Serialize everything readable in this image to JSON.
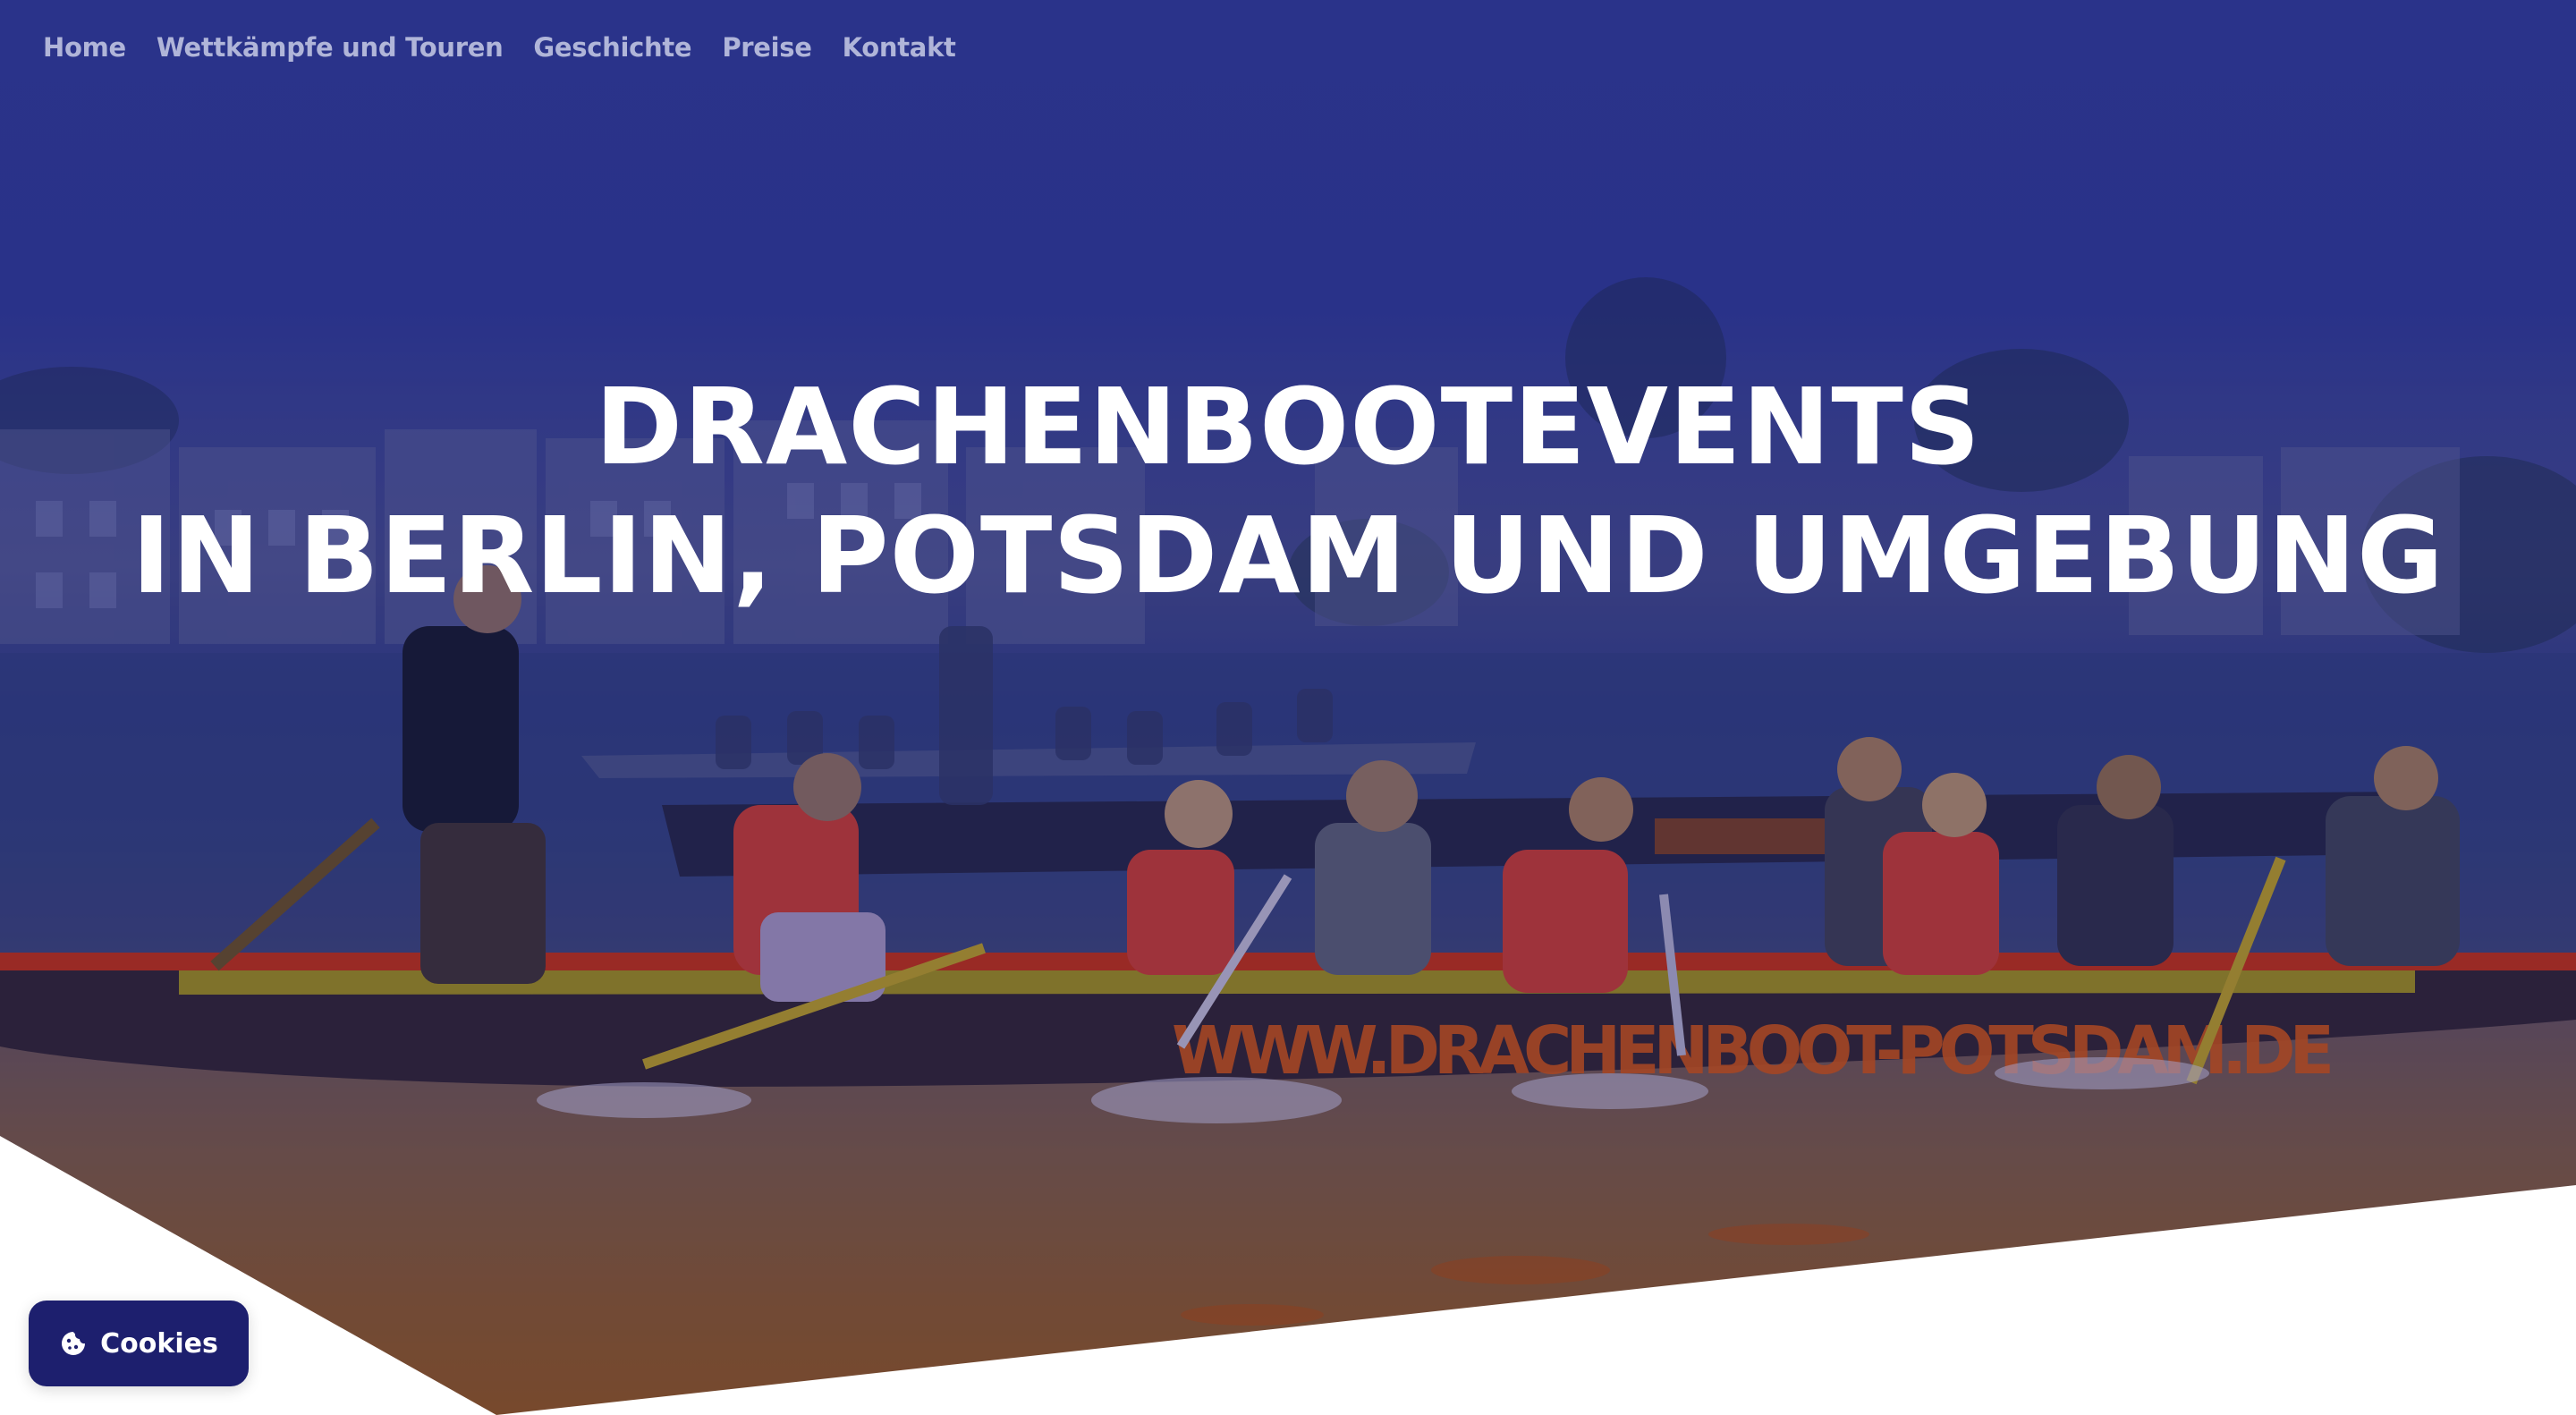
{
  "nav": {
    "items": [
      {
        "label": "Home"
      },
      {
        "label": "Wettkämpfe und Touren"
      },
      {
        "label": "Geschichte"
      },
      {
        "label": "Preise"
      },
      {
        "label": "Kontakt"
      }
    ]
  },
  "hero": {
    "headline_line1": "DRACHENBOOTEVENTS",
    "headline_line2": "IN BERLIN, POTSDAM UND UMGEBUNG",
    "image_alt": "Drachenboot mit Paddlern auf dem Wasser",
    "boat_lettering": "WWW.DRACHENBOOT-POTSDAM.DE",
    "overlay_color": "#2b2f8f"
  },
  "cookie": {
    "label": "Cookies",
    "icon": "cookie-icon",
    "color": "#1d1f6e"
  }
}
